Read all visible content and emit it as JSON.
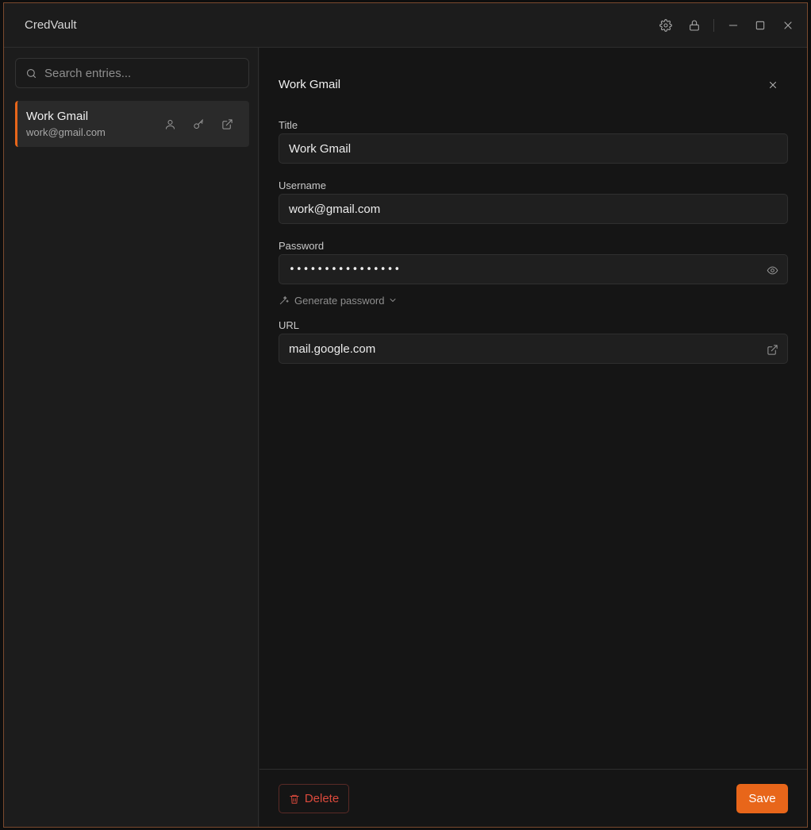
{
  "app": {
    "title": "CredVault"
  },
  "titlebar": {
    "icons": [
      "gear-icon",
      "lock-icon",
      "minimize-icon",
      "maximize-icon",
      "close-icon"
    ]
  },
  "sidebar": {
    "search": {
      "placeholder": "Search entries...",
      "value": ""
    },
    "entries": [
      {
        "title": "Work Gmail",
        "subtitle": "work@gmail.com",
        "selected": true,
        "actions": [
          "user-icon",
          "key-icon",
          "external-link-icon"
        ]
      }
    ]
  },
  "detail": {
    "heading": "Work Gmail",
    "fields": {
      "title": {
        "label": "Title",
        "value": "Work Gmail"
      },
      "username": {
        "label": "Username",
        "value": "work@gmail.com"
      },
      "password": {
        "label": "Password",
        "value": "••••••••••••••••"
      },
      "url": {
        "label": "URL",
        "value": "mail.google.com"
      }
    },
    "generate_label": "Generate password",
    "delete_label": "Delete",
    "save_label": "Save"
  },
  "colors": {
    "accent": "#e8661a",
    "danger": "#dc4a3c",
    "background": "#151515"
  }
}
